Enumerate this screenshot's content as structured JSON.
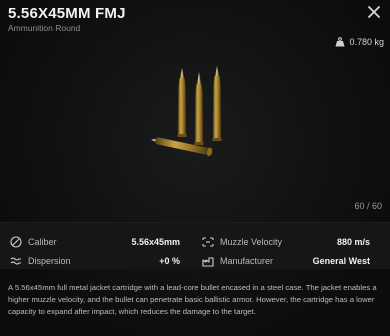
{
  "item": {
    "name": "5.56X45MM FMJ",
    "category": "Ammunition Round",
    "weight": "0.780 kg",
    "weight_icon": "weight-icon",
    "stack": "60 / 60"
  },
  "stats": {
    "caliber_label": "Caliber",
    "caliber_value": "5.56x45mm",
    "dispersion_label": "Dispersion",
    "dispersion_value": "+0 %",
    "velocity_label": "Muzzle Velocity",
    "velocity_value": "880 m/s",
    "manufacturer_label": "Manufacturer",
    "manufacturer_value": "General West"
  },
  "description": "A 5.56x45mm full metal jacket cartridge with a lead-core bullet encased in a steel case. The jacket enables a higher muzzle velocity, and the bullet can penetrate basic ballistic armor. However, the cartridge has a lower capacity to expand after impact, which reduces the damage to the target.",
  "colors": {
    "background": "#0b0c0c",
    "stats_band": "#151616",
    "brass": "#b08a2e"
  }
}
